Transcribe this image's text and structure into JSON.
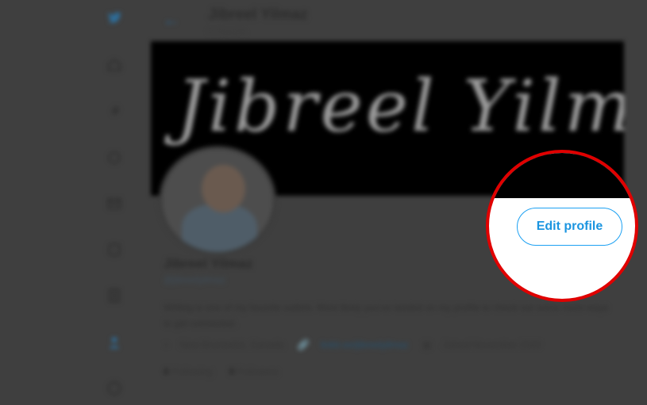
{
  "header": {
    "back_icon": "arrow-left-icon",
    "title": "Jibreel Yilmaz",
    "tweet_count": "0 Tweets"
  },
  "banner": {
    "signature": "Jibreel Yilmaz"
  },
  "profile": {
    "name": "Jibreel Yilmaz",
    "handle": "@jibreelyilmaz",
    "bio": "Writing is one of my favorite outlets. Most likely you've landed on my profile to check out some more ways to get connected.",
    "location": "New Brunswick, Canada",
    "website": "linktr.ee/jibreelyilmaz",
    "joined": "Joined November 2020",
    "following_count": "0",
    "following_label": "Following",
    "followers_count": "0",
    "followers_label": "Followers"
  },
  "sidebar": {
    "icons": [
      "twitter-logo-icon",
      "home-icon",
      "explore-icon",
      "notifications-icon",
      "messages-icon",
      "bookmarks-icon",
      "lists-icon",
      "profile-icon",
      "more-icon"
    ]
  },
  "actions": {
    "edit_profile_label": "Edit profile"
  },
  "colors": {
    "accent": "#1da1f2",
    "highlight_ring": "#e00000",
    "banner": "#000000"
  }
}
